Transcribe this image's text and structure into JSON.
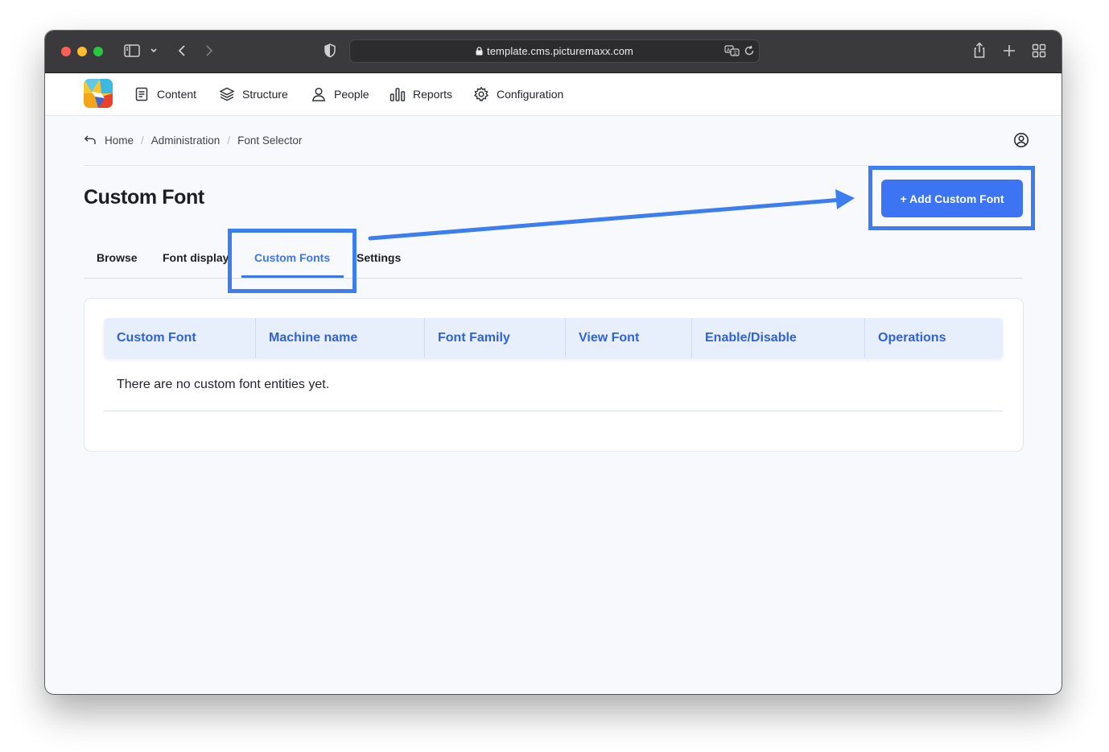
{
  "browser": {
    "url": "template.cms.picturemaxx.com"
  },
  "nav": {
    "items": [
      {
        "label": "Content",
        "icon": "document-icon"
      },
      {
        "label": "Structure",
        "icon": "layers-icon"
      },
      {
        "label": "People",
        "icon": "person-icon"
      },
      {
        "label": "Reports",
        "icon": "bar-chart-icon"
      },
      {
        "label": "Configuration",
        "icon": "gear-icon"
      }
    ]
  },
  "breadcrumb": {
    "items": [
      "Home",
      "Administration",
      "Font Selector"
    ]
  },
  "page": {
    "title": "Custom Font",
    "add_button": "+ Add Custom Font"
  },
  "tabs": [
    {
      "label": "Browse",
      "active": false
    },
    {
      "label": "Font display",
      "active": false
    },
    {
      "label": "Custom Fonts",
      "active": true
    },
    {
      "label": "Settings",
      "active": false
    }
  ],
  "table": {
    "columns": [
      "Custom Font",
      "Machine name",
      "Font Family",
      "View Font",
      "Enable/Disable",
      "Operations"
    ],
    "empty_message": "There are no custom font entities yet."
  },
  "colors": {
    "accent": "#3d74f4",
    "annotation": "#3c7df0",
    "table_header_bg": "#e8effc"
  }
}
